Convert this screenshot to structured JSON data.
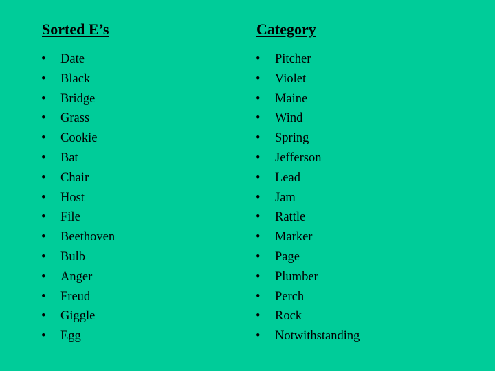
{
  "left": {
    "heading": "Sorted E’s",
    "items": [
      "Date",
      "Black",
      "Bridge",
      "Grass",
      "Cookie",
      "Bat",
      "Chair",
      "Host",
      "File",
      "Beethoven",
      "Bulb",
      "Anger",
      "Freud",
      "Giggle",
      "Egg"
    ]
  },
  "right": {
    "heading": "Category",
    "items": [
      "Pitcher",
      "Violet",
      "Maine",
      "Wind",
      "Spring",
      "Jefferson",
      "Lead",
      "Jam",
      "Rattle",
      "Marker",
      "Page",
      "Plumber",
      "Perch",
      "Rock",
      "Notwithstanding"
    ]
  },
  "bullet": "•",
  "background_color": "#00CC99"
}
